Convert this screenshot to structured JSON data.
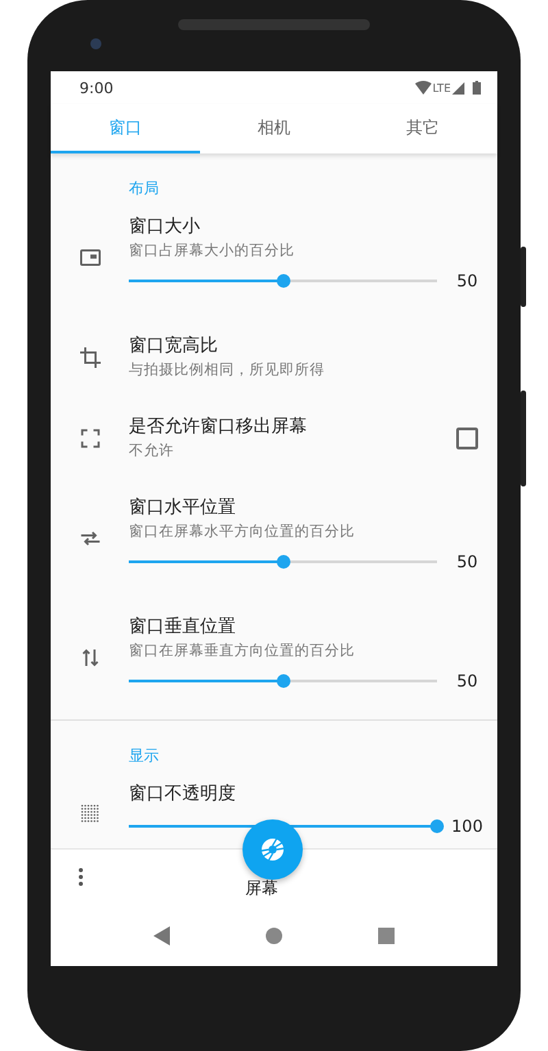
{
  "status_bar": {
    "time": "9:00",
    "network": "LTE"
  },
  "tabs": [
    {
      "label": "窗口",
      "selected": true
    },
    {
      "label": "相机",
      "selected": false
    },
    {
      "label": "其它",
      "selected": false
    }
  ],
  "sections": [
    {
      "title": "布局",
      "items": [
        {
          "kind": "slider",
          "title": "窗口大小",
          "subtitle": "窗口占屏幕大小的百分比",
          "level": 0.5,
          "reading": "50"
        },
        {
          "kind": "plain",
          "title": "窗口宽高比",
          "subtitle": "与拍摄比例相同，所见即所得"
        },
        {
          "kind": "checkbox",
          "title": "是否允许窗口移出屏幕",
          "subtitle": "不允许",
          "checked": false
        },
        {
          "kind": "slider",
          "title": "窗口水平位置",
          "subtitle": "窗口在屏幕水平方向位置的百分比",
          "level": 0.5,
          "reading": "50"
        },
        {
          "kind": "slider",
          "title": "窗口垂直位置",
          "subtitle": "窗口在屏幕垂直方向位置的百分比",
          "level": 0.5,
          "reading": "50"
        }
      ]
    },
    {
      "title": "显示",
      "items": [
        {
          "kind": "slider",
          "title": "窗口不透明度",
          "level": 1,
          "reading": "100"
        }
      ]
    }
  ],
  "bottom_bar": {
    "label": "屏幕"
  }
}
